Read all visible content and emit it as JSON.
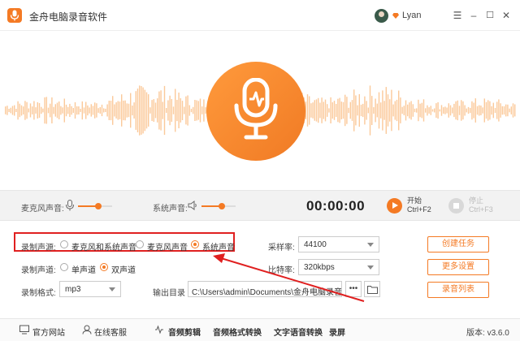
{
  "app": {
    "title": "金舟电脑录音软件"
  },
  "user": {
    "name": "Lyan"
  },
  "window": {
    "menu": "☰",
    "minimize": "–",
    "maximize": "☐",
    "close": "✕"
  },
  "controls": {
    "mic_label": "麦克风声音:",
    "mic_level": 0.6,
    "system_label": "系统声音:",
    "system_level": 0.6,
    "timer": "00:00:00",
    "start_label": "开始",
    "start_shortcut": "Ctrl+F2",
    "stop_label": "停止",
    "stop_shortcut": "Ctrl+F3"
  },
  "settings": {
    "source": {
      "label": "录制声源:",
      "options": [
        "麦克风和系统声音",
        "麦克风声音",
        "系统声音"
      ],
      "selected": 2
    },
    "channel": {
      "label": "录制声道:",
      "options": [
        "单声道",
        "双声道"
      ],
      "selected": 1
    },
    "format": {
      "label": "录制格式:",
      "value": "mp3"
    },
    "sample_rate": {
      "label": "采样率:",
      "value": "44100"
    },
    "bitrate": {
      "label": "比特率:",
      "value": "320kbps"
    },
    "output": {
      "label": "输出目录",
      "value": "C:\\Users\\admin\\Documents\\金舟电脑录音软",
      "more": "•••"
    },
    "actions": [
      "创建任务",
      "更多设置",
      "录音列表"
    ]
  },
  "footer": {
    "items": [
      "官方网站",
      "在线客服",
      "音频剪辑",
      "音频格式转换",
      "文字语音转换",
      "录屏"
    ],
    "version_label": "版本:",
    "version": "v3.6.0"
  },
  "colors": {
    "accent": "#f47a24",
    "highlight_box": "#e02020",
    "wave": "#fbc99a"
  }
}
